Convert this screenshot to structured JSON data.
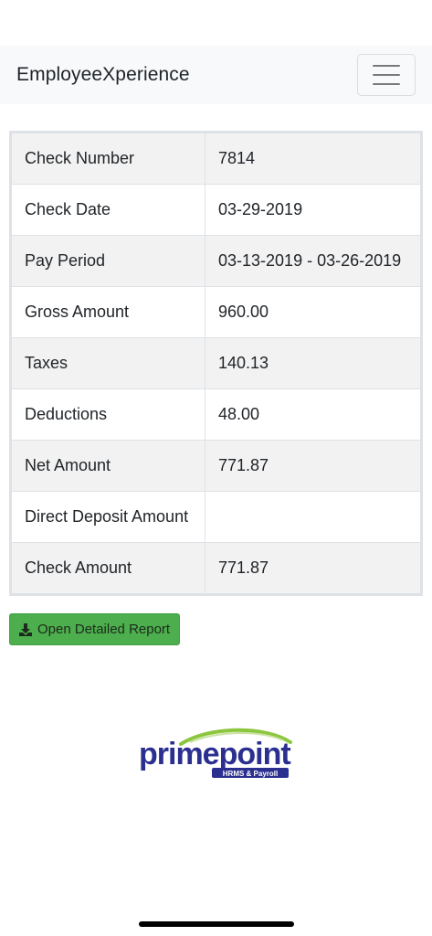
{
  "navbar": {
    "brand": "EmployeeXperience",
    "menu_icon": "hamburger-menu-icon"
  },
  "check_details": [
    {
      "label": "Check Number",
      "value": "7814"
    },
    {
      "label": "Check Date",
      "value": "03-29-2019"
    },
    {
      "label": "Pay Period",
      "value": "03-13-2019 - 03-26-2019"
    },
    {
      "label": "Gross Amount",
      "value": "960.00"
    },
    {
      "label": "Taxes",
      "value": "140.13"
    },
    {
      "label": "Deductions",
      "value": "48.00"
    },
    {
      "label": "Net Amount",
      "value": "771.87"
    },
    {
      "label": "Direct Deposit Amount",
      "value": ""
    },
    {
      "label": "Check Amount",
      "value": "771.87"
    }
  ],
  "actions": {
    "report_button_label": "Open Detailed Report",
    "report_button_icon": "download-icon",
    "button_color": "#4cae4c"
  },
  "footer": {
    "logo_text": "primepoint",
    "logo_tagline": "HRMS & Payroll",
    "logo_colors": {
      "primary": "#2b2f8f",
      "accent": "#8cc63f"
    }
  }
}
